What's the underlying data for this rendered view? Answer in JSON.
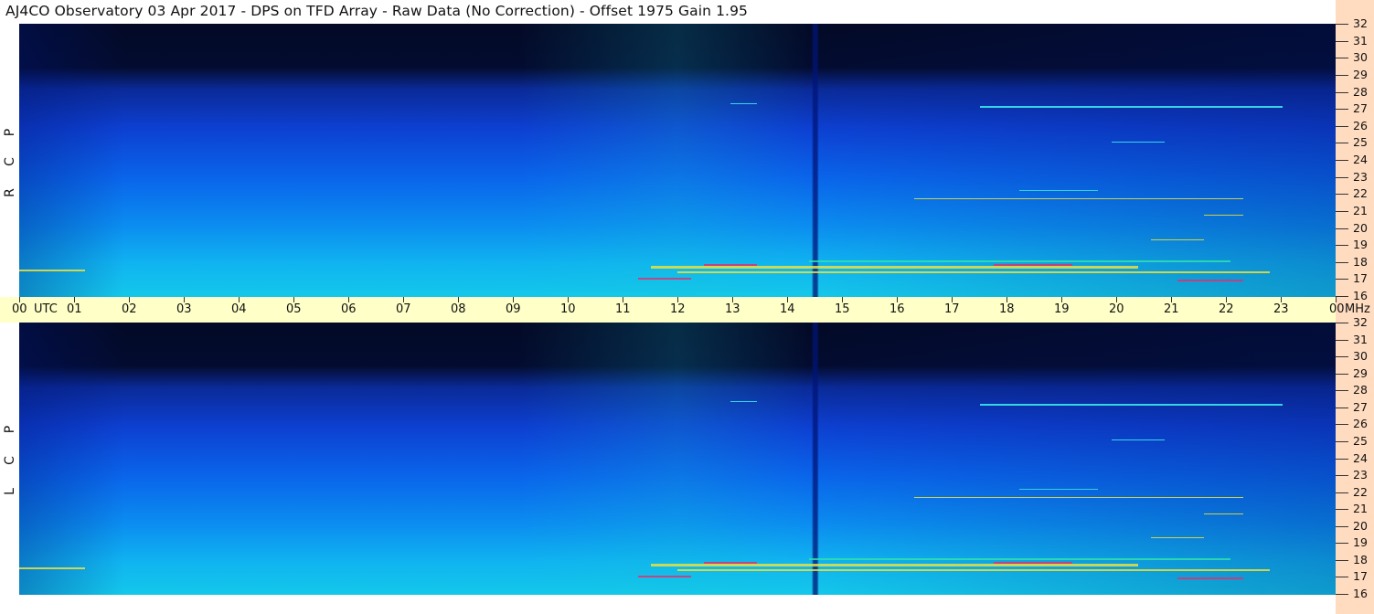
{
  "title": "AJ4CO Observatory  03 Apr 2017  -  DPS on TFD Array  -  Raw Data (No Correction)  -  Offset 1975  Gain 1.95",
  "time_axis": {
    "labels": [
      "00",
      "01",
      "02",
      "03",
      "04",
      "05",
      "06",
      "07",
      "08",
      "09",
      "10",
      "11",
      "12",
      "13",
      "14",
      "15",
      "16",
      "17",
      "18",
      "19",
      "20",
      "21",
      "22",
      "23",
      "00"
    ],
    "unit_label": "UTC"
  },
  "freq_axis": {
    "labels": [
      "32",
      "31",
      "30",
      "29",
      "28",
      "27",
      "26",
      "25",
      "24",
      "23",
      "22",
      "21",
      "20",
      "19",
      "18",
      "17",
      "16"
    ],
    "unit_label": "MHz"
  },
  "panels": [
    {
      "id": "rcp",
      "letters": [
        "P",
        "C",
        "R"
      ]
    },
    {
      "id": "lcp",
      "letters": [
        "P",
        "C",
        "L"
      ]
    }
  ],
  "chart_data": {
    "type": "heatmap",
    "title": "AJ4CO Observatory  03 Apr 2017  -  DPS on TFD Array  -  Raw Data (No Correction)  -  Offset 1975  Gain 1.95",
    "xlabel": "UTC",
    "ylabel": "MHz",
    "x_range": [
      0,
      24
    ],
    "y_range": [
      16,
      32
    ],
    "series": [
      {
        "name": "RCP"
      },
      {
        "name": "LCP"
      }
    ],
    "colors": {
      "low": "#030a26",
      "mid": "#0b64ea",
      "high": "#14c8ea",
      "hot": "#f0e030",
      "peak": "#e03070"
    }
  }
}
